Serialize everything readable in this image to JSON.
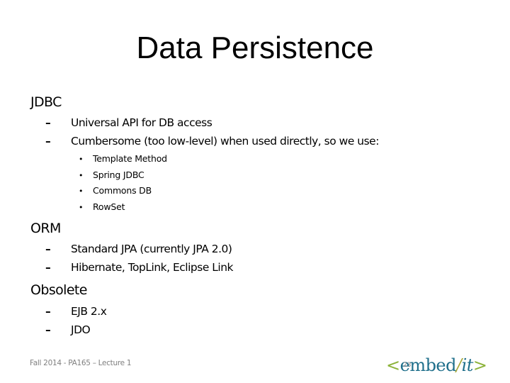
{
  "slide": {
    "title": "Data Persistence",
    "sections": [
      {
        "heading": "JDBC",
        "items": [
          {
            "text": "Universal API for DB access",
            "subitems": []
          },
          {
            "text": "Cumbersome (too low-level) when used directly, so we use:",
            "subitems": [
              "Template Method",
              "Spring JDBC",
              "Commons DB",
              "RowSet"
            ]
          }
        ]
      },
      {
        "heading": "ORM",
        "items": [
          {
            "text": "Standard JPA (currently JPA 2.0)",
            "subitems": []
          },
          {
            "text": "Hibernate, TopLink, Eclipse Link",
            "subitems": []
          }
        ]
      },
      {
        "heading": "Obsolete",
        "items": [
          {
            "text": "EJB 2.x",
            "subitems": []
          },
          {
            "text": "JDO",
            "subitems": []
          }
        ]
      }
    ],
    "bullet_level2": "–",
    "bullet_level3": "•"
  },
  "footer": {
    "text": "Fall 2014 - PA165 – Lecture 1",
    "page_number": "23"
  },
  "logo": {
    "open_bracket": "<",
    "word": "embed",
    "slash": "/",
    "suffix": "it",
    "close_bracket": ">",
    "colors": {
      "brackets": "#8db33a",
      "text": "#1f6f8b",
      "slash": "#a6a83a"
    }
  }
}
